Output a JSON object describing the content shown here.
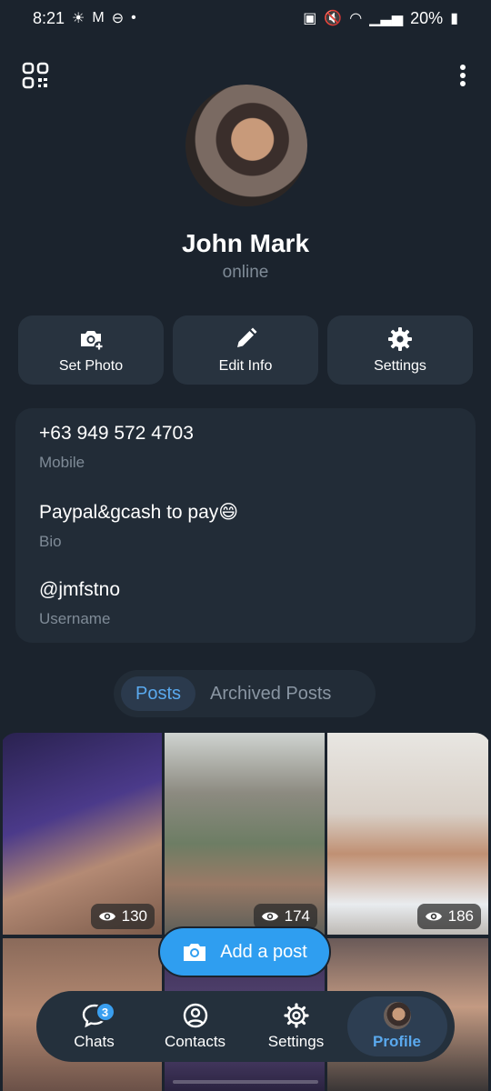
{
  "status_bar": {
    "time": "8:21",
    "battery": "20%"
  },
  "profile": {
    "name": "John Mark",
    "presence": "online"
  },
  "actions": {
    "set_photo": "Set Photo",
    "edit_info": "Edit Info",
    "settings": "Settings"
  },
  "info": {
    "phone": "+63 949 572 4703",
    "phone_label": "Mobile",
    "bio": "Paypal&gcash to pay😄",
    "bio_label": "Bio",
    "username": "@jmfstno",
    "username_label": "Username"
  },
  "tabs": {
    "posts": "Posts",
    "archived": "Archived Posts"
  },
  "posts": {
    "views": [
      "130",
      "174",
      "186"
    ]
  },
  "add_post_label": "Add a post",
  "nav": {
    "chats": "Chats",
    "chats_badge": "3",
    "contacts": "Contacts",
    "settings": "Settings",
    "profile": "Profile"
  },
  "colors": {
    "background": "#1b232d",
    "card": "#222c37",
    "accent": "#2f9ef0",
    "muted_text": "#7f8b97"
  }
}
